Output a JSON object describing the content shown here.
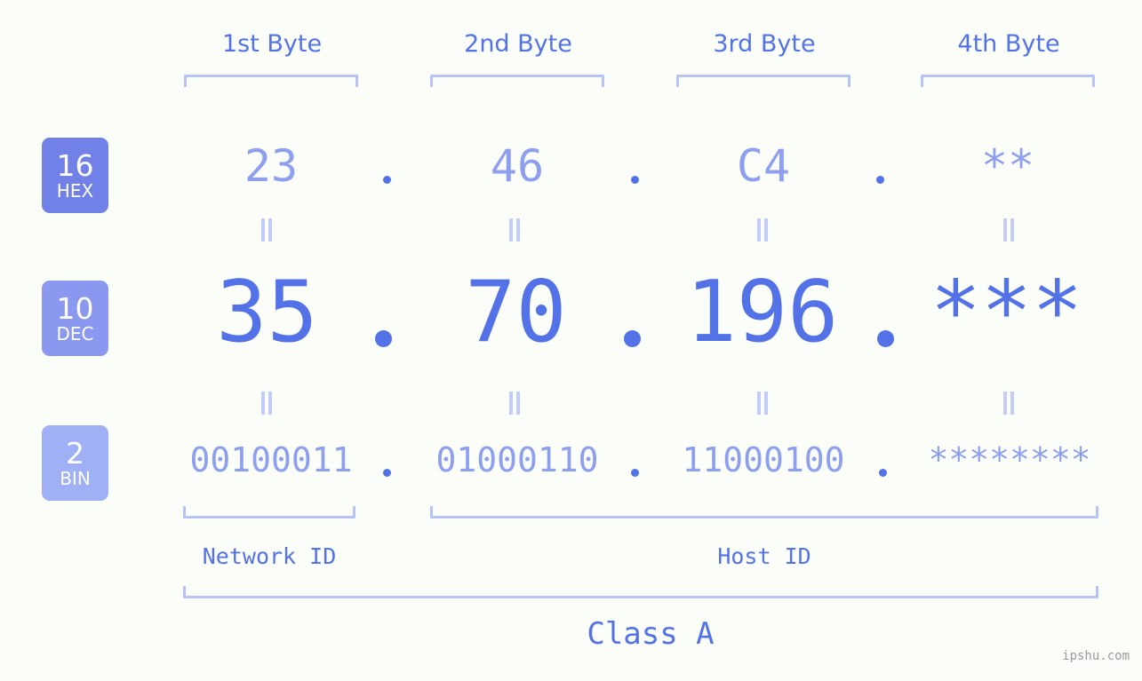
{
  "byte_headers": [
    {
      "label": "1st Byte"
    },
    {
      "label": "2nd Byte"
    },
    {
      "label": "3rd Byte"
    },
    {
      "label": "4th Byte"
    }
  ],
  "bases": [
    {
      "number": "16",
      "name": "HEX",
      "color": "#7181e8"
    },
    {
      "number": "10",
      "name": "DEC",
      "color": "#8a98ef"
    },
    {
      "number": "2",
      "name": "BIN",
      "color": "#9fb0f4"
    }
  ],
  "rows": {
    "hex": {
      "values": [
        "23",
        "46",
        "C4",
        "**"
      ]
    },
    "dec": {
      "values": [
        "35",
        "70",
        "196",
        "***"
      ]
    },
    "bin": {
      "values": [
        "00100011",
        "01000110",
        "11000100",
        "********"
      ]
    }
  },
  "separator": ".",
  "connector": "=",
  "sections": {
    "network_id": "Network ID",
    "host_id": "Host ID",
    "class": "Class A"
  },
  "watermark": "ipshu.com",
  "colors": {
    "background": "#fafdf8",
    "accent_strong": "#5472e8",
    "accent_light": "#8e9ff0",
    "bracket": "#b7c2f7"
  }
}
